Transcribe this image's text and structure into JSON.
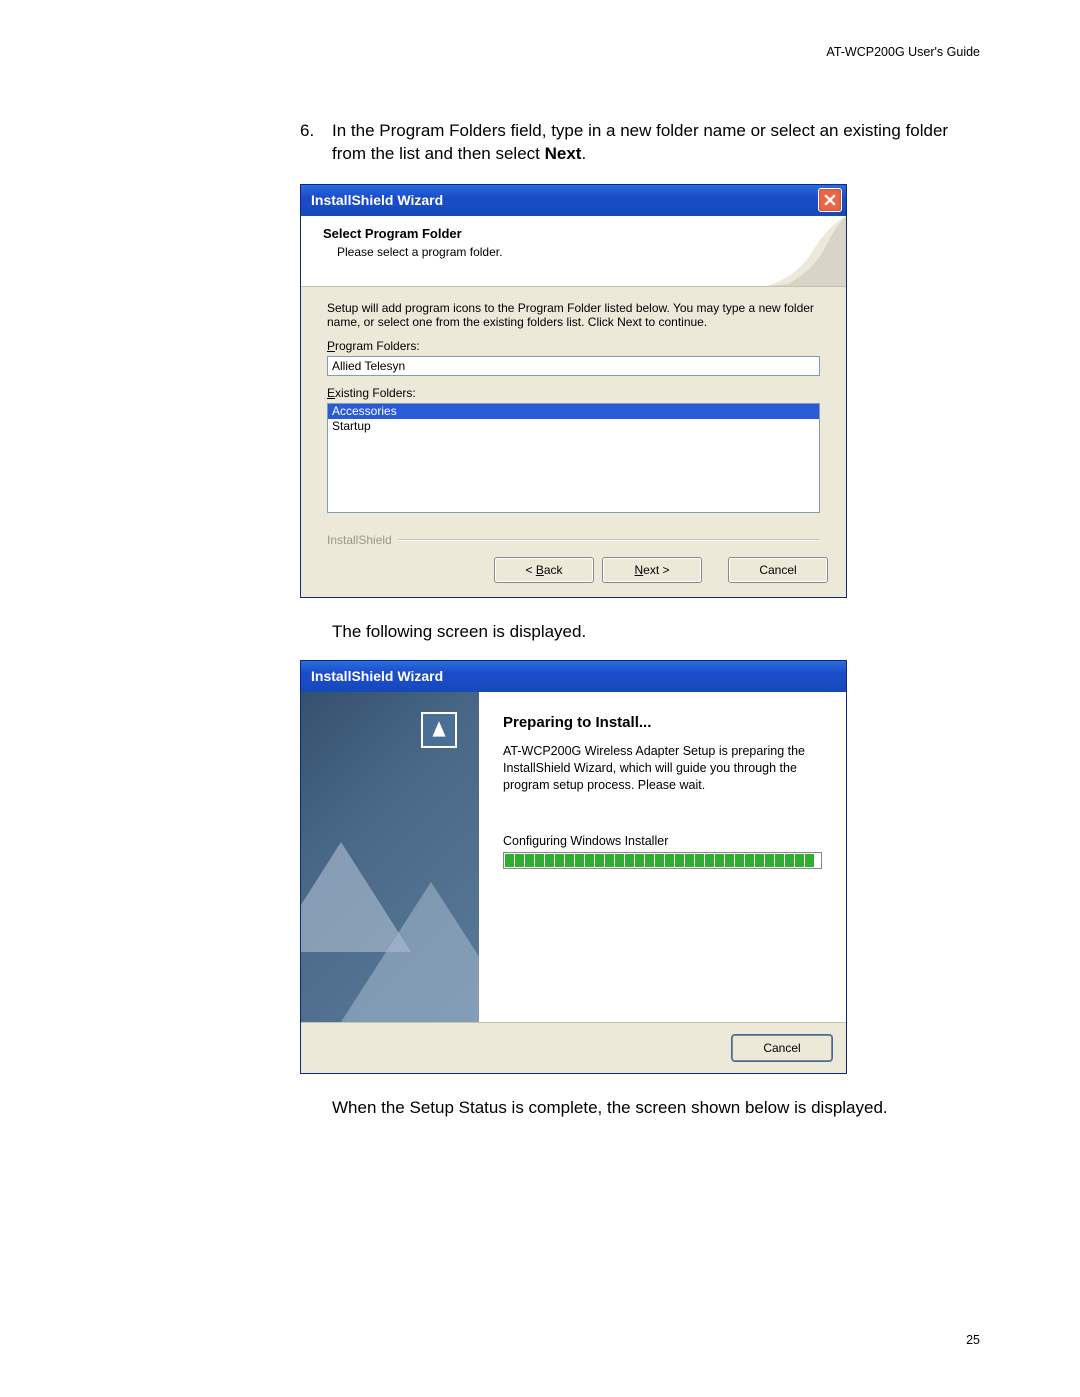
{
  "header": {
    "guide_title": "AT-WCP200G User's Guide"
  },
  "step": {
    "number": "6.",
    "text_part1": "In the Program Folders field, type in a new folder name or select an existing folder from the list and then select ",
    "text_bold": "Next",
    "text_part2": "."
  },
  "dialog1": {
    "title": "InstallShield Wizard",
    "heading": "Select Program Folder",
    "subheading": "Please select a program folder.",
    "description": "Setup will add program icons to the Program Folder listed below.  You may type a new folder name, or select one from the existing folders list.  Click Next to continue.",
    "program_folders_label_pre": "P",
    "program_folders_label_post": "rogram Folders:",
    "program_folders_value": "Allied Telesyn",
    "existing_folders_label_pre": "E",
    "existing_folders_label_post": "xisting Folders:",
    "existing_items": [
      "Accessories",
      "Startup"
    ],
    "brand": "InstallShield",
    "buttons": {
      "back": "< Back",
      "next": "Next >",
      "cancel": "Cancel"
    }
  },
  "paragraph1": "The following screen is displayed.",
  "dialog2": {
    "title": "InstallShield Wizard",
    "heading": "Preparing to Install...",
    "description": "AT-WCP200G Wireless Adapter Setup is preparing the InstallShield Wizard, which will guide you through the program setup process.  Please wait.",
    "progress_label": "Configuring Windows Installer",
    "progress_segments": 31,
    "cancel": "Cancel"
  },
  "paragraph2": "When the Setup Status is complete, the screen shown below is displayed.",
  "page_number": "25"
}
